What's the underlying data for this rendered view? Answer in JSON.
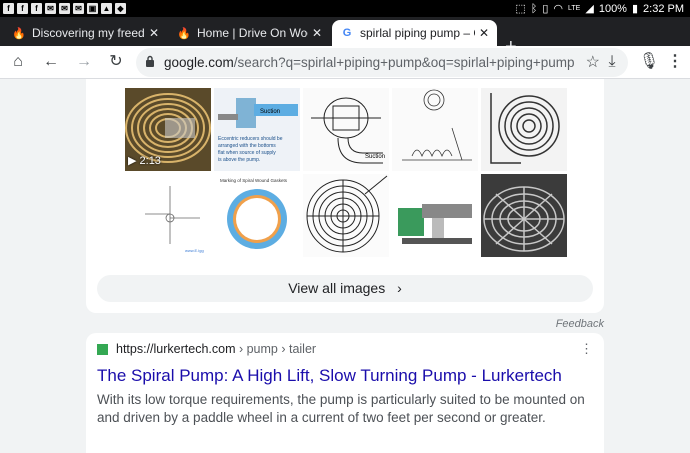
{
  "status_bar": {
    "battery": "100%",
    "time": "2:32 PM",
    "network": "LTE"
  },
  "tabs": [
    {
      "title": "Discovering my freedom",
      "favicon": "flame-icon",
      "active": false
    },
    {
      "title": "Home | Drive On Wood!",
      "favicon": "flame-icon",
      "active": false
    },
    {
      "title": "spirlal piping pump – Goo",
      "favicon": "google-g-icon",
      "active": true
    }
  ],
  "toolbar": {
    "url_domain": "google.com",
    "url_path": "/search?q=spirlal+piping+pump&oq=spirlal+piping+pump&aq"
  },
  "images": {
    "video_duration": "2:13",
    "view_all_label": "View all images",
    "thumb_labels": {
      "suction": "Suction",
      "reducer_note": "Eccentric reducers should be arranged with the bottoms flat when source of supply is above the pump.",
      "suction2": "Suction",
      "gasket_title": "Marking of Spiral Wound Gaskets"
    }
  },
  "feedback_label": "Feedback",
  "result": {
    "cite_base": "https://lurkertech.com",
    "cite_path": " › pump › tailer",
    "title": "The Spiral Pump: A High Lift, Slow Turning Pump - Lurkertech",
    "snippet": "With its low torque requirements, the pump is particularly suited to be mounted on and driven by a paddle wheel in a current of two feet per second or greater."
  },
  "colors": {
    "link": "#1a0dab",
    "tab_strip": "#202124",
    "page_bg": "#f1f3f4"
  }
}
